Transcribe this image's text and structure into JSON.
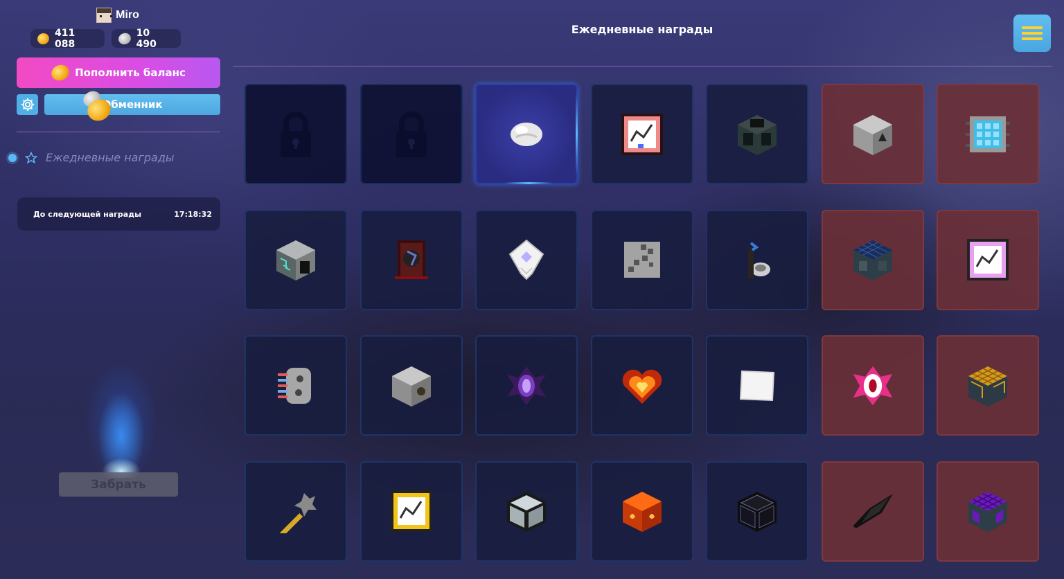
{
  "user": {
    "name": "Miro"
  },
  "balances": {
    "gold": "411 088",
    "silver": "10 490"
  },
  "actions": {
    "topup_label": "Пополнить баланс",
    "exchange_label": "Обменник"
  },
  "nav": {
    "items": [
      {
        "label": "Ежедневные награды"
      }
    ]
  },
  "timer": {
    "label": "До следующей награды",
    "value": "17:18:32"
  },
  "claim": {
    "label": "Забрать"
  },
  "main": {
    "title": "Ежедневные награды"
  },
  "rewards": [
    {
      "item": "locked-icon",
      "state": "locked",
      "premium": false
    },
    {
      "item": "locked-icon",
      "state": "locked",
      "premium": false
    },
    {
      "item": "silver-orb-icon",
      "state": "active",
      "premium": false
    },
    {
      "item": "pink-gauge-icon",
      "state": "normal",
      "premium": false
    },
    {
      "item": "dark-machine-block-icon",
      "state": "normal",
      "premium": false
    },
    {
      "item": "stone-arrow-block-icon",
      "state": "normal",
      "premium": true
    },
    {
      "item": "cyan-grid-chip-icon",
      "state": "normal",
      "premium": true
    },
    {
      "item": "teal-circuit-block-icon",
      "state": "normal",
      "premium": false
    },
    {
      "item": "dark-spellbook-icon",
      "state": "normal",
      "premium": false
    },
    {
      "item": "white-crystal-icon",
      "state": "normal",
      "premium": false
    },
    {
      "item": "gray-plate-icon",
      "state": "normal",
      "premium": false
    },
    {
      "item": "pedestal-icon",
      "state": "normal",
      "premium": false
    },
    {
      "item": "solar-panel-block-icon",
      "state": "normal",
      "premium": true
    },
    {
      "item": "magenta-gauge-icon",
      "state": "normal",
      "premium": true
    },
    {
      "item": "gear-component-icon",
      "state": "normal",
      "premium": false
    },
    {
      "item": "stone-gear-block-icon",
      "state": "normal",
      "premium": false
    },
    {
      "item": "purple-eye-icon",
      "state": "normal",
      "premium": false
    },
    {
      "item": "fire-heart-icon",
      "state": "normal",
      "premium": false
    },
    {
      "item": "white-tile-icon",
      "state": "normal",
      "premium": false
    },
    {
      "item": "red-eye-icon",
      "state": "normal",
      "premium": true
    },
    {
      "item": "gold-grid-block-icon",
      "state": "normal",
      "premium": true
    },
    {
      "item": "wand-icon",
      "state": "normal",
      "premium": false
    },
    {
      "item": "gold-gauge-icon",
      "state": "normal",
      "premium": false
    },
    {
      "item": "glass-frame-block-icon",
      "state": "normal",
      "premium": false
    },
    {
      "item": "lava-block-icon",
      "state": "normal",
      "premium": false
    },
    {
      "item": "black-frame-block-icon",
      "state": "normal",
      "premium": false
    },
    {
      "item": "obsidian-shard-icon",
      "state": "normal",
      "premium": true
    },
    {
      "item": "purple-grid-block-icon",
      "state": "normal",
      "premium": true
    }
  ],
  "colors": {
    "accent_blue": "#4fb0e8",
    "accent_pink": "#f24ac3",
    "premium_red": "#6a3036",
    "menu_yellow": "#ffd12a"
  }
}
